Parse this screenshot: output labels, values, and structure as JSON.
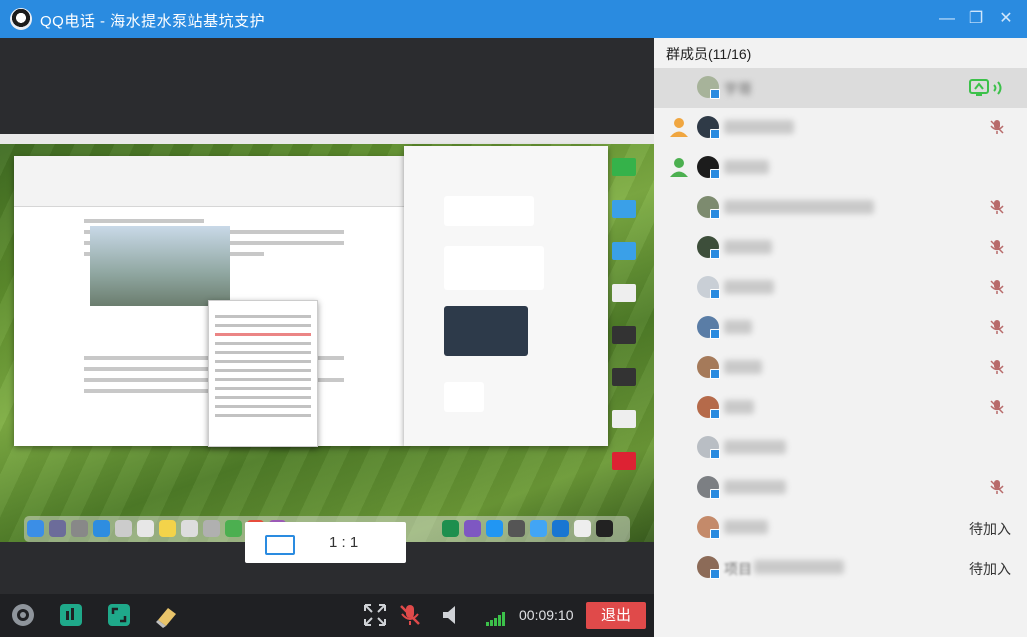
{
  "window": {
    "title": "QQ电话 - 海水提水泵站基坑支护",
    "controls": [
      "minimize-icon",
      "restore-icon",
      "close-icon"
    ]
  },
  "ratio_popup": {
    "label": "1 : 1",
    "icon": "aspect-ratio-icon"
  },
  "toolbar": {
    "timer": "00:09:10",
    "exit_label": "退出",
    "icons": [
      "camera-icon",
      "share-screen-icon",
      "fullscreen-window-icon",
      "eraser-icon",
      "expand-icon",
      "mic-muted-icon",
      "speaker-icon",
      "signal-icon"
    ],
    "exit_color": "#e04a4a"
  },
  "members_panel": {
    "header": "群成员(11/16)",
    "members": [
      {
        "name": "宇哥",
        "status": "sharing",
        "selected": true
      },
      {
        "name": "",
        "status": "muted"
      },
      {
        "name": "",
        "status": "speaking"
      },
      {
        "name": "",
        "status": "muted"
      },
      {
        "name": "",
        "status": "muted"
      },
      {
        "name": "",
        "status": "muted"
      },
      {
        "name": "",
        "status": "muted"
      },
      {
        "name": "",
        "status": "muted"
      },
      {
        "name": "",
        "status": "muted"
      },
      {
        "name": "",
        "status": "none"
      },
      {
        "name": "",
        "status": "muted"
      },
      {
        "name": "",
        "status": "pending",
        "pending_label": "待加入"
      },
      {
        "name": "项目",
        "status": "pending",
        "pending_label": "待加入"
      }
    ]
  },
  "colors": {
    "accent": "#2a8be0",
    "panel_bg": "#f2f2f2",
    "muted_mic": "#c0392b",
    "sharing_green": "#3cc14a"
  }
}
